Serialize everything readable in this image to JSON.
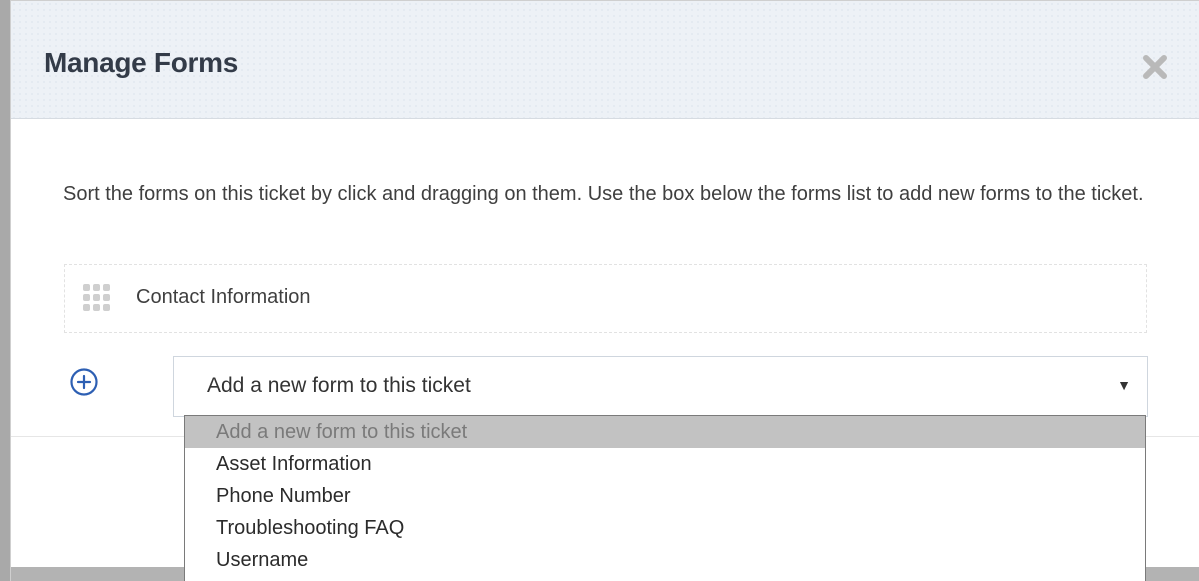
{
  "modal": {
    "title": "Manage Forms",
    "close_icon": "close-icon"
  },
  "body": {
    "description": "Sort the forms on this ticket by click and dragging on them. Use the box below the forms list to add new forms to the ticket.",
    "forms": [
      {
        "label": "Contact Information",
        "icon": "drag-handle-icon"
      }
    ],
    "add_icon": "plus-circle-icon",
    "select": {
      "value": "Add a new form to this ticket",
      "arrow_icon": "caret-down-icon",
      "options": [
        "Add a new form to this ticket",
        "Asset Information",
        "Phone Number",
        "Troubleshooting FAQ",
        "Username"
      ],
      "highlighted_index": 0
    }
  },
  "colors": {
    "header_bg": "#edf1f6",
    "title_text": "#333b48",
    "accent_blue": "#2d5fb3",
    "highlight_option_bg": "#c2c2c2"
  }
}
